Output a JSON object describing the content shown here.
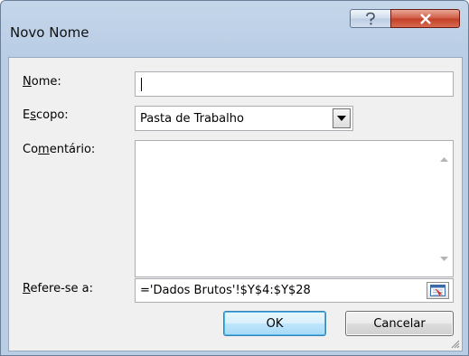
{
  "window": {
    "title": "Novo Nome"
  },
  "form": {
    "name_label": "Nome:",
    "name_value": "",
    "scope_label": "Escopo:",
    "scope_value": "Pasta de Trabalho",
    "comment_label": "Comentário:",
    "comment_value": "",
    "refers_label": "Refere-se a:",
    "refers_value": "='Dados Brutos'!$Y$4:$Y$28"
  },
  "buttons": {
    "ok": "OK",
    "cancel": "Cancelar"
  },
  "icons": {
    "help": "help-icon",
    "close": "close-icon",
    "dropdown": "chevron-down-icon",
    "scroll_up": "scroll-up-icon",
    "scroll_down": "scroll-down-icon",
    "collapse": "collapse-dialog-icon",
    "resize": "resize-grip-icon"
  },
  "colors": {
    "close_red": "#c23f26",
    "ok_border": "#3c7fb1"
  }
}
